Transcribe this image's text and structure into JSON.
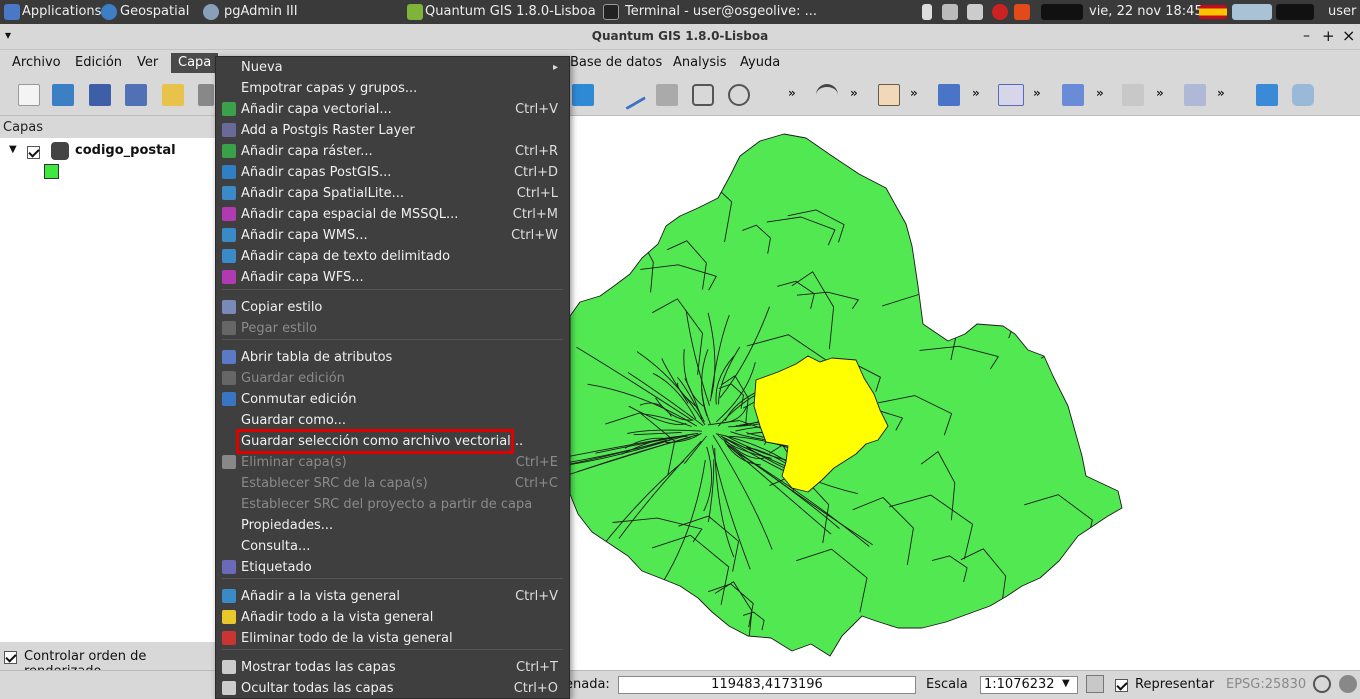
{
  "panel": {
    "applications": "Applications",
    "geospatial": "Geospatial",
    "pgadmin": "pgAdmin III",
    "qgis_task": "Quantum GIS 1.8.0-Lisboa",
    "terminal_task": "Terminal - user@osgeolive: ...",
    "clock": "vie, 22 nov  18:45",
    "user": "user"
  },
  "window": {
    "title": "Quantum GIS 1.8.0-Lisboa",
    "minimize": "–",
    "maximize": "+",
    "close": "×",
    "menu_arrow": "▾"
  },
  "menubar": [
    "Archivo",
    "Edición",
    "Ver",
    "Capa",
    "Base de datos",
    "Analysis",
    "Ayuda"
  ],
  "toolbar": {
    "chevron": "»"
  },
  "layers": {
    "title": "Capas",
    "layer_name": "codigo_postal",
    "layer_color": "#3ee83e",
    "render_order": "Controlar orden de renderizado"
  },
  "menu": {
    "items": [
      {
        "label": "Nueva",
        "shortcut": "",
        "disabled": false,
        "submenu": true
      },
      {
        "label": "Empotrar capas y grupos...",
        "shortcut": "",
        "disabled": false
      },
      {
        "label": "Añadir capa vectorial...",
        "shortcut": "Ctrl+V",
        "disabled": false
      },
      {
        "label": "Add a Postgis Raster Layer",
        "shortcut": "",
        "disabled": false
      },
      {
        "label": "Añadir capa ráster...",
        "shortcut": "Ctrl+R",
        "disabled": false
      },
      {
        "label": "Añadir capas PostGIS...",
        "shortcut": "Ctrl+D",
        "disabled": false
      },
      {
        "label": "Añadir capa SpatialLite...",
        "shortcut": "Ctrl+L",
        "disabled": false
      },
      {
        "label": "Añadir capa espacial de MSSQL...",
        "shortcut": "Ctrl+M",
        "disabled": false
      },
      {
        "label": "Añadir capa WMS...",
        "shortcut": "Ctrl+W",
        "disabled": false
      },
      {
        "label": "Añadir capa de texto delimitado",
        "shortcut": "",
        "disabled": false
      },
      {
        "label": "Añadir capa WFS...",
        "shortcut": "",
        "disabled": false
      },
      {
        "label": "Copiar estilo",
        "shortcut": "",
        "disabled": false
      },
      {
        "label": "Pegar estilo",
        "shortcut": "",
        "disabled": true
      },
      {
        "label": "Abrir tabla de atributos",
        "shortcut": "",
        "disabled": false
      },
      {
        "label": "Guardar edición",
        "shortcut": "",
        "disabled": true
      },
      {
        "label": "Conmutar edición",
        "shortcut": "",
        "disabled": false
      },
      {
        "label": "Guardar como...",
        "shortcut": "",
        "disabled": false
      },
      {
        "label": "Guardar selección como archivo vectorial...",
        "shortcut": "",
        "disabled": false
      },
      {
        "label": "Eliminar capa(s)",
        "shortcut": "Ctrl+E",
        "disabled": true
      },
      {
        "label": "Establecer SRC de la capa(s)",
        "shortcut": "Ctrl+C",
        "disabled": true
      },
      {
        "label": "Establecer SRC del proyecto a partir de capa",
        "shortcut": "",
        "disabled": true
      },
      {
        "label": "Propiedades...",
        "shortcut": "",
        "disabled": false
      },
      {
        "label": "Consulta...",
        "shortcut": "",
        "disabled": false
      },
      {
        "label": "Etiquetado",
        "shortcut": "",
        "disabled": false
      },
      {
        "label": "Añadir a la vista general",
        "shortcut": "Ctrl+V",
        "disabled": false
      },
      {
        "label": "Añadir todo a la vista general",
        "shortcut": "",
        "disabled": false
      },
      {
        "label": "Eliminar todo de la vista general",
        "shortcut": "",
        "disabled": false
      },
      {
        "label": "Mostrar todas las capas",
        "shortcut": "Ctrl+T",
        "disabled": false
      },
      {
        "label": "Ocultar todas las capas",
        "shortcut": "Ctrl+O",
        "disabled": false
      }
    ]
  },
  "statusbar": {
    "coord_label": "enada:",
    "coordinate": "119483,4173196",
    "scale_label": "Escala",
    "scale": "1:1076232",
    "render_label": "Representar",
    "epsg": "EPSG:25830"
  },
  "colors": {
    "polygon_fill": "#52e852",
    "selected_fill": "#ffff00",
    "highlight_box": "#e00000"
  }
}
